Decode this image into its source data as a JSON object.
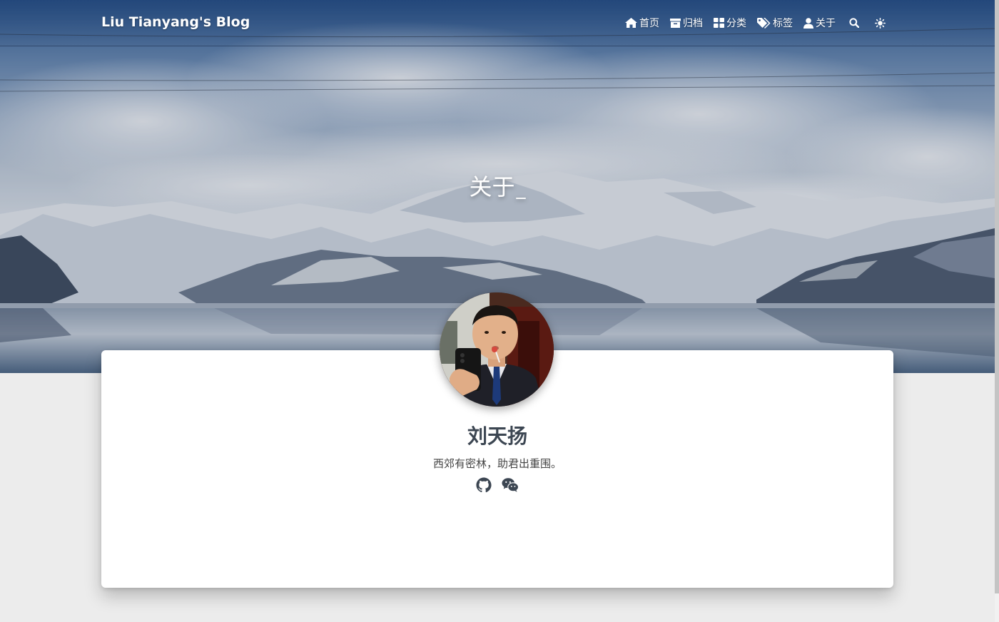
{
  "site": {
    "brand": "Liu Tianyang's Blog"
  },
  "nav": {
    "items": [
      {
        "label": "首页",
        "icon": "home-icon"
      },
      {
        "label": "归档",
        "icon": "archive-icon"
      },
      {
        "label": "分类",
        "icon": "th-large-icon"
      },
      {
        "label": "标签",
        "icon": "tags-icon"
      },
      {
        "label": "关于",
        "icon": "user-icon"
      }
    ],
    "search_icon": "search-icon",
    "theme_icon": "sun-icon"
  },
  "banner": {
    "title": "关于",
    "cursor": "_"
  },
  "profile": {
    "name": "刘天扬",
    "bio": "西郊有密林，助君出重围。",
    "social": [
      {
        "icon": "github-icon"
      },
      {
        "icon": "wechat-icon"
      }
    ]
  },
  "colors": {
    "page_bg": "#ececec",
    "card_bg": "#ffffff",
    "name_color": "#3c4652",
    "sky_top": "#2d5b95"
  }
}
